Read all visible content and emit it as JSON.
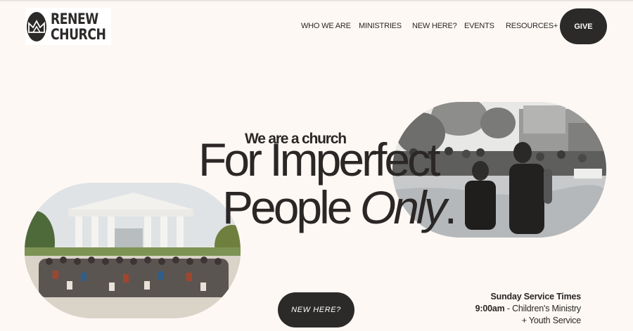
{
  "logo": {
    "line1": "RENEW",
    "line2": "CHURCH"
  },
  "nav": {
    "items": [
      "WHO WE ARE",
      "MINISTRIES",
      "NEW HERE?",
      "EVENTS",
      "RESOURCES+"
    ],
    "give": "GIVE"
  },
  "hero": {
    "tagline": "We are a church",
    "headline_line1": "For Imperfect",
    "headline_line2_a": "People ",
    "headline_line2_b": "Only",
    "headline_line2_c": "."
  },
  "cta": {
    "new_here": "NEW HERE?"
  },
  "service": {
    "title": "Sunday Service Times",
    "time": "9:00am",
    "line1_rest": " - Children's Ministry",
    "line2": "+ Youth Service"
  },
  "colors": {
    "background": "#fdf8f4",
    "dark": "#2c2a29",
    "text": "#2a2726"
  },
  "icons": {
    "logo_mark": "crown-icon"
  }
}
